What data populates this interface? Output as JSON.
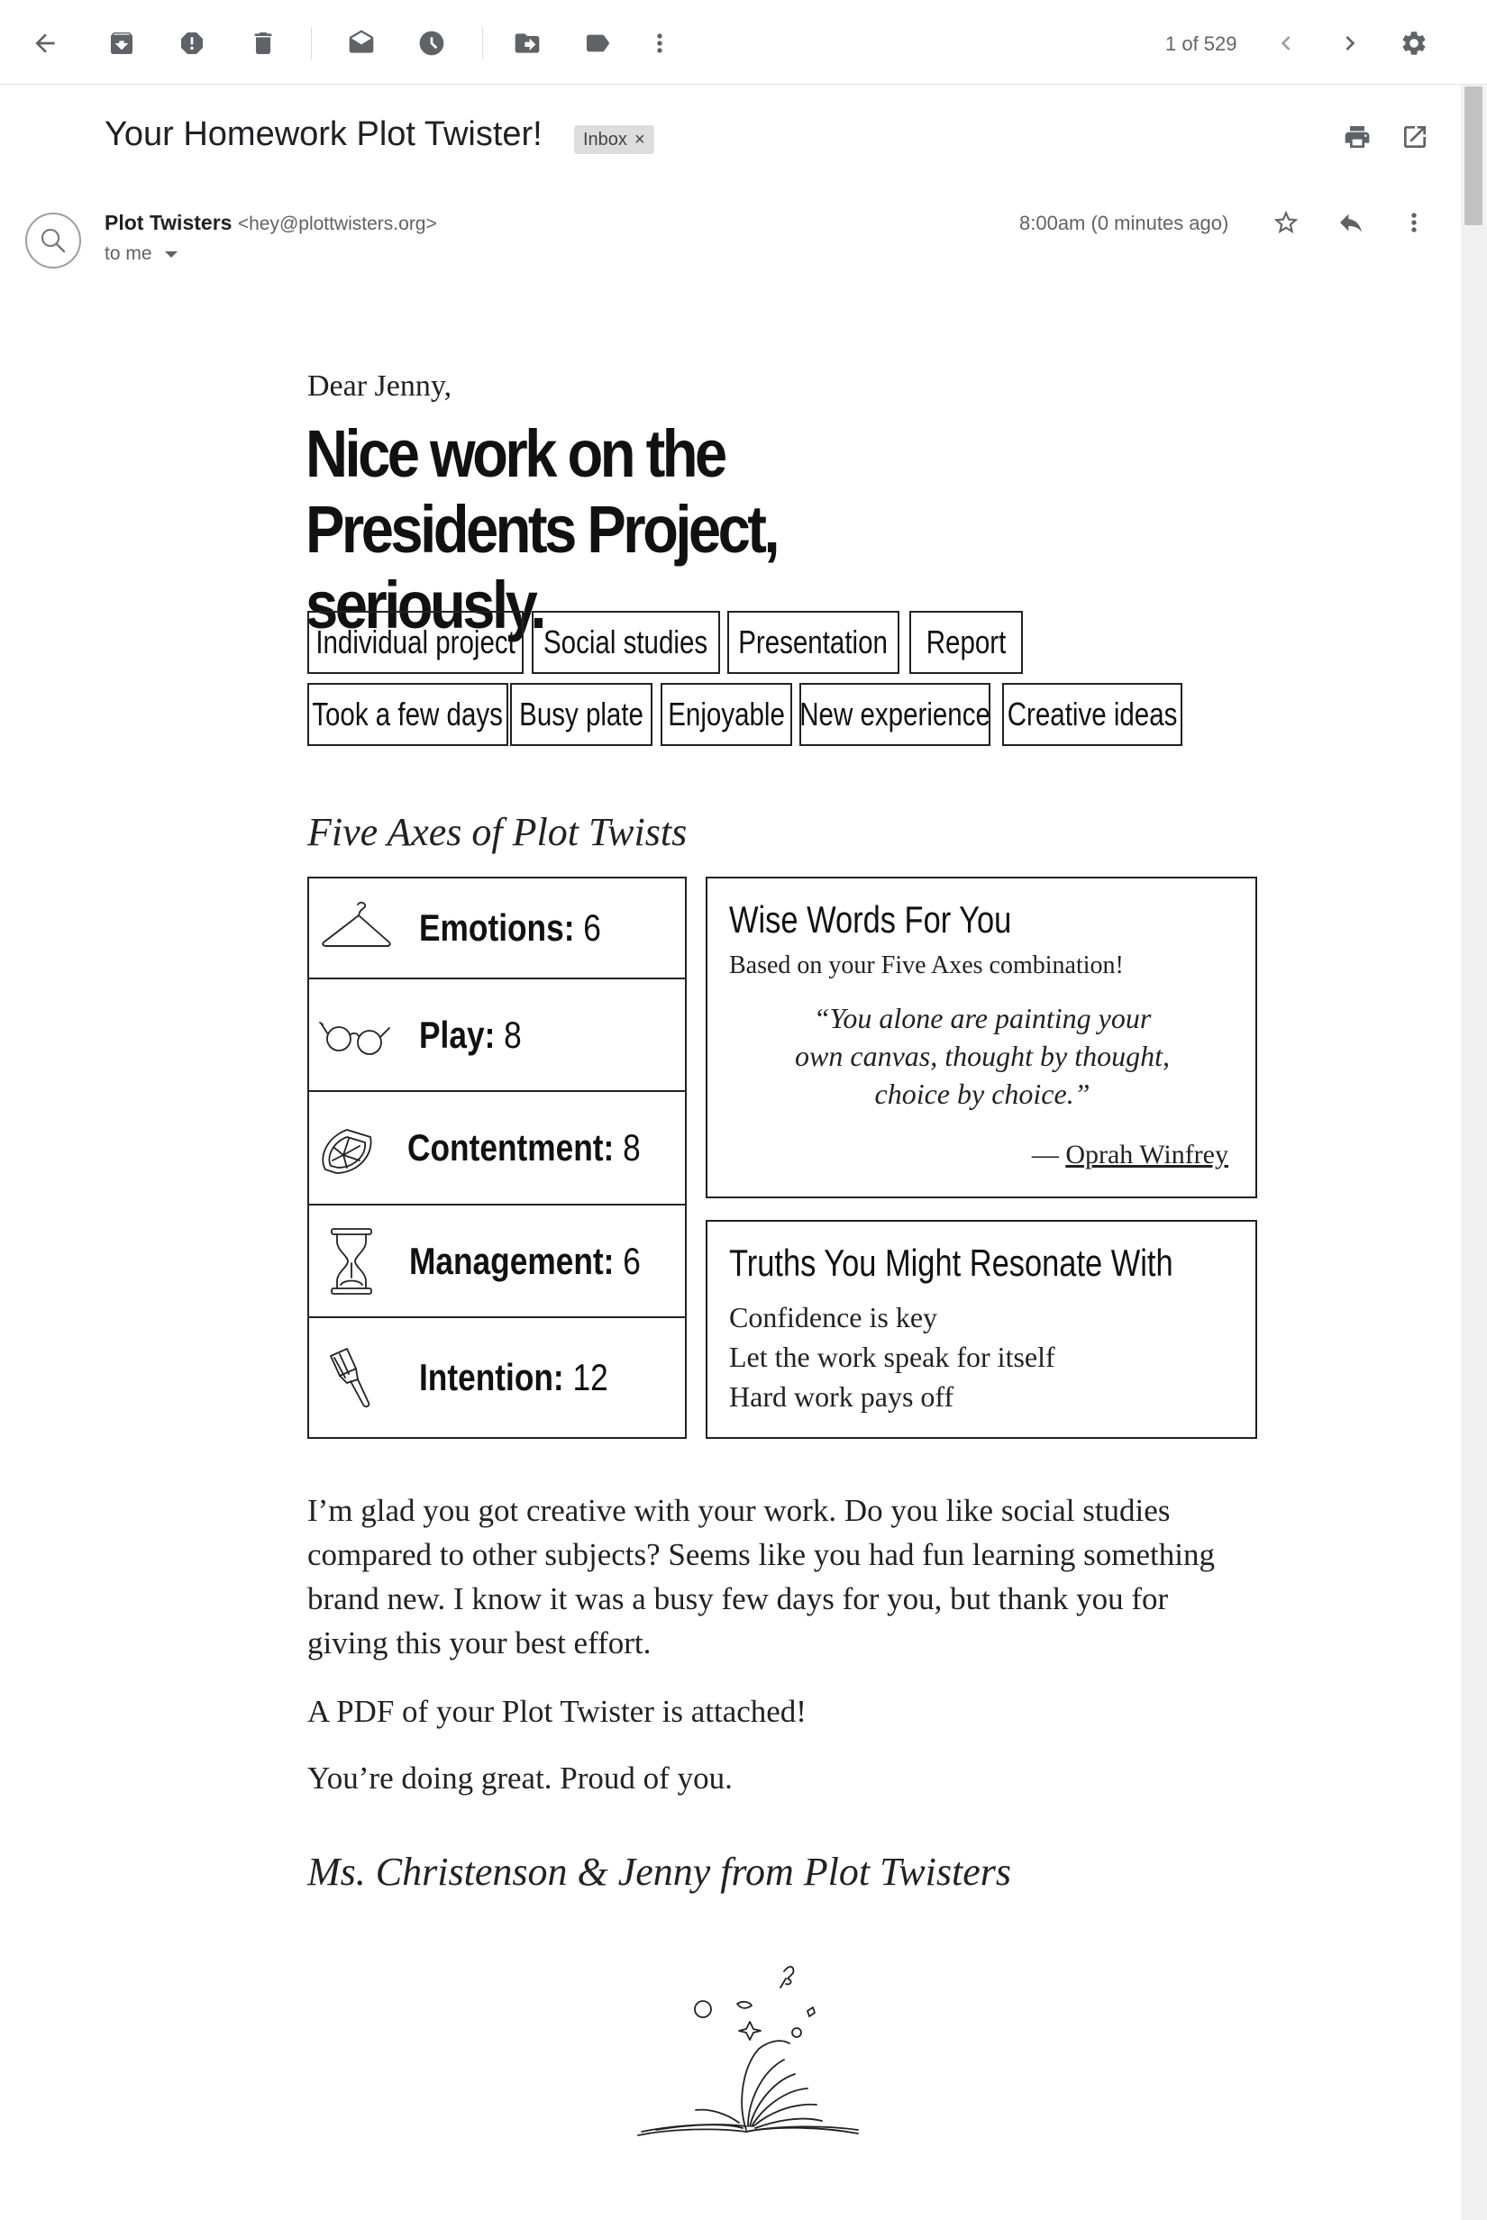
{
  "toolbar": {
    "pager_text": "1 of 529"
  },
  "email": {
    "subject": "Your Homework Plot Twister!",
    "label_chip": "Inbox",
    "label_remove": "×",
    "sender_name": "Plot Twisters",
    "sender_email": "<hey@plottwisters.org>",
    "recipient_line": "to me",
    "timestamp": "8:00am (0 minutes ago)"
  },
  "body": {
    "greeting": "Dear Jenny,",
    "headline": "Nice work on the Presidents Project, seriously.",
    "tags_row1": [
      "Individual project",
      "Social studies",
      "Presentation",
      "Report"
    ],
    "tags_row2": [
      "Took a few days",
      "Busy plate",
      "Enjoyable",
      "New experience",
      "Creative ideas"
    ],
    "axes_title": "Five Axes of Plot Twists",
    "axes": [
      {
        "label": "Emotions:",
        "value": "6",
        "icon": "hanger-icon"
      },
      {
        "label": "Play:",
        "value": "8",
        "icon": "glasses-icon"
      },
      {
        "label": "Contentment:",
        "value": "8",
        "icon": "lemon-slice-icon"
      },
      {
        "label": "Management:",
        "value": "6",
        "icon": "hourglass-icon"
      },
      {
        "label": "Intention:",
        "value": "12",
        "icon": "paintbrush-icon"
      }
    ],
    "wise": {
      "title": "Wise Words For You",
      "subtitle": "Based on your Five Axes combination!",
      "quote": "“You alone are painting your own canvas, thought by thought, choice by choice.”",
      "dash": "— ",
      "author": "Oprah Winfrey"
    },
    "truths": {
      "title": "Truths You Might Resonate With",
      "items": [
        "Confidence is key",
        "Let the work speak for itself",
        "Hard work pays off"
      ]
    },
    "paragraph1": "I’m glad you got creative with your work. Do you like social studies compared to other subjects? Seems like you had fun learning something brand new. I know it was a busy few days for you, but thank you for giving this your best effort.",
    "paragraph2": "A PDF of your Plot Twister is attached!",
    "paragraph3": "You’re doing great. Proud of you.",
    "signature": "Ms. Christenson & Jenny from Plot Twisters"
  }
}
